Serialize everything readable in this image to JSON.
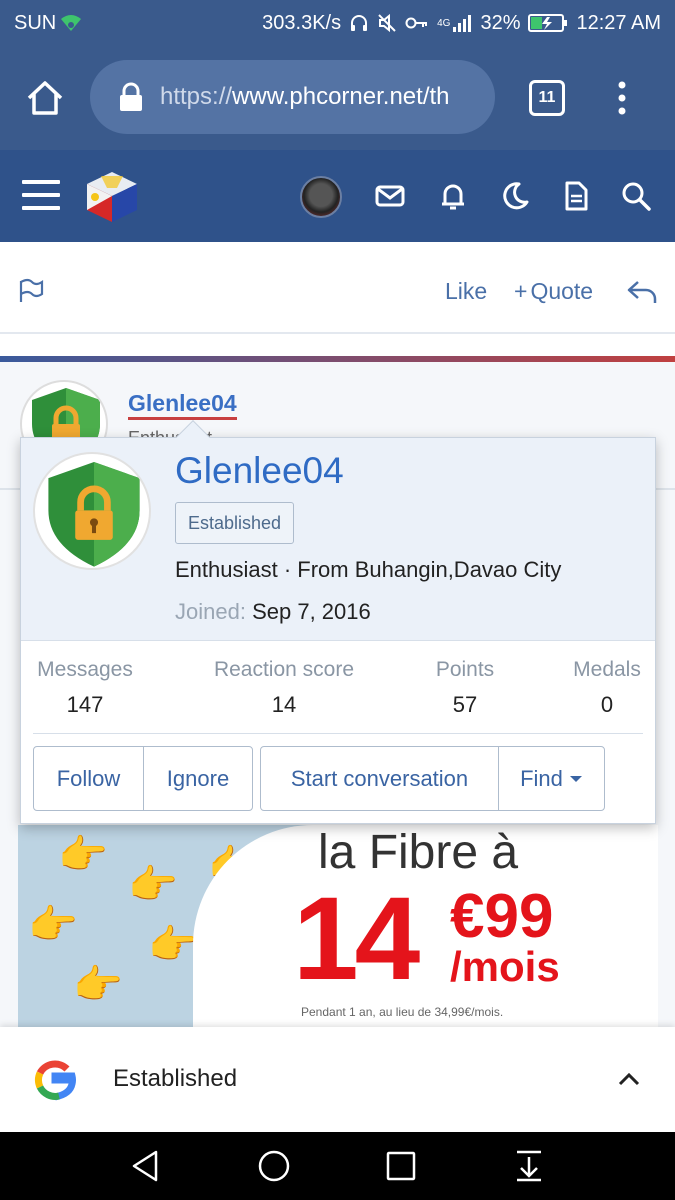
{
  "status_bar": {
    "carrier": "SUN",
    "speed": "303.3K/s",
    "network": "4G",
    "battery": "32%",
    "time": "12:27 AM"
  },
  "browser": {
    "url_scheme": "https://",
    "url_rest": "www.phcorner.net/th",
    "tab_count": "11"
  },
  "post_actions": {
    "like": "Like",
    "quote": "Quote"
  },
  "post": {
    "username": "Glenlee04",
    "subtitle": "Enthusiast"
  },
  "member_card": {
    "name": "Glenlee04",
    "badge": "Established",
    "title_line": "Enthusiast · From Buhangin,Davao City",
    "joined_label": "Joined:",
    "joined_value": "Sep 7, 2016",
    "stats": [
      {
        "label": "Messages",
        "value": "147"
      },
      {
        "label": "Reaction score",
        "value": "14"
      },
      {
        "label": "Points",
        "value": "57"
      },
      {
        "label": "Medals",
        "value": "0"
      }
    ],
    "buttons": {
      "follow": "Follow",
      "ignore": "Ignore",
      "start_conversation": "Start conversation",
      "find": "Find"
    }
  },
  "ad": {
    "title": "la Fibre à",
    "price_main": "14",
    "price_cents": "€99",
    "price_period": "/mois",
    "fineprint": "Pendant 1 an, au lieu de 34,99€/mois."
  },
  "google_bar": {
    "text": "Established"
  },
  "colors": {
    "header": "#2f528a",
    "browser": "#3a5a8c",
    "link": "#2f6bc4",
    "ad_red": "#e4141b"
  }
}
